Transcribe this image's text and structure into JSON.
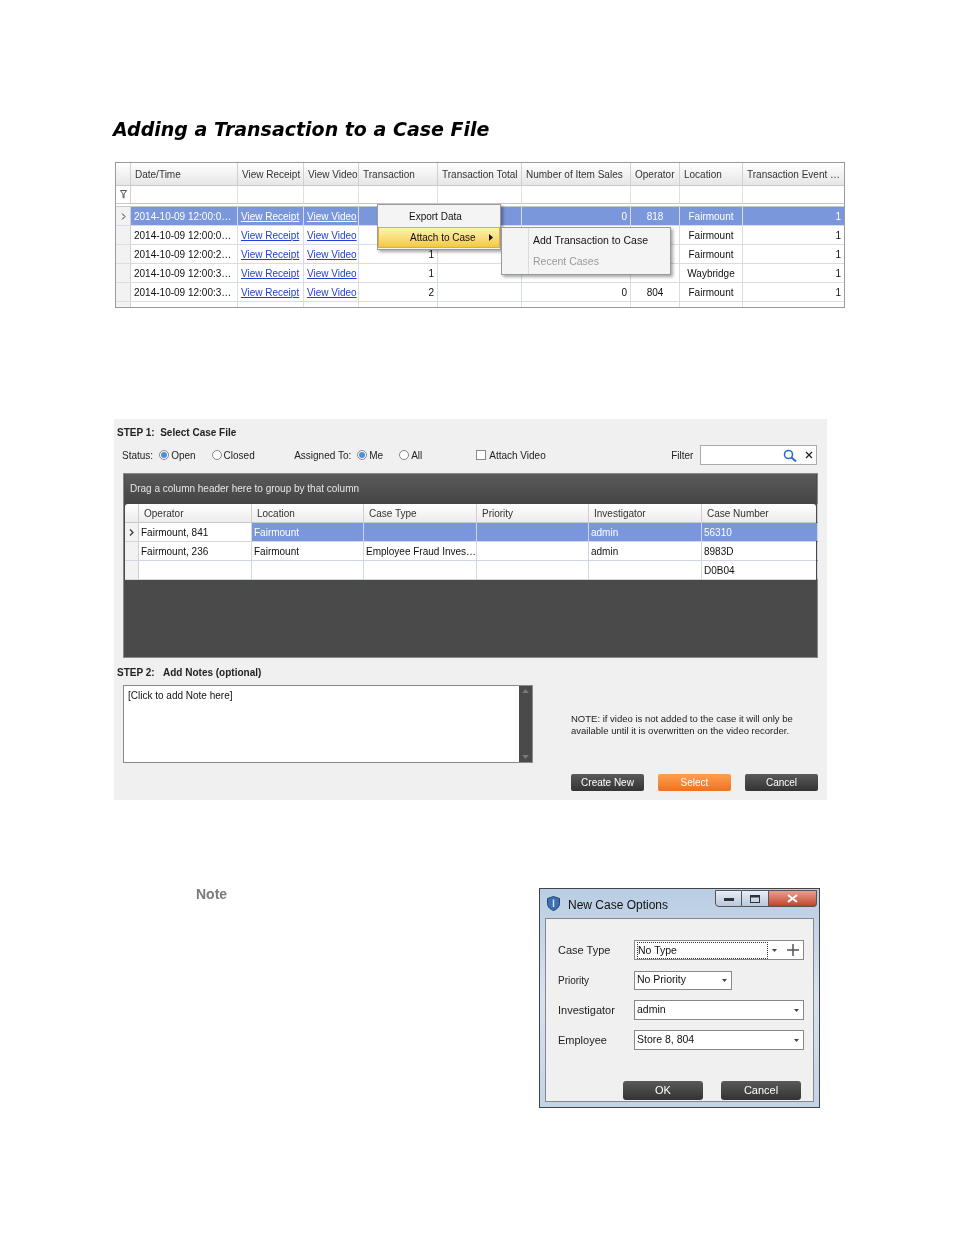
{
  "title": "Adding a Transaction to a Case File",
  "transactions_grid": {
    "columns": [
      {
        "label": "Date/Time",
        "kind": "text"
      },
      {
        "label": "View Receipt",
        "kind": "link"
      },
      {
        "label": "View Video",
        "kind": "link"
      },
      {
        "label": "Transaction",
        "kind": "number"
      },
      {
        "label": "Transaction Total",
        "kind": "number"
      },
      {
        "label": "Number of Item Sales",
        "kind": "number"
      },
      {
        "label": "Operator",
        "kind": "center"
      },
      {
        "label": "Location",
        "kind": "center"
      },
      {
        "label": "Transaction Event …",
        "kind": "number"
      }
    ],
    "rows": [
      {
        "selected": true,
        "cells": [
          "2014-10-09 12:00:0…",
          "View Receipt",
          "View Video",
          null,
          null,
          "0",
          "818",
          "Fairmount",
          "1"
        ]
      },
      {
        "selected": false,
        "cells": [
          "2014-10-09 12:00:0…",
          "View Receipt",
          "View Video",
          null,
          null,
          null,
          null,
          "Fairmount",
          "1"
        ]
      },
      {
        "selected": false,
        "cells": [
          "2014-10-09 12:00:2…",
          "View Receipt",
          "View Video",
          "1",
          null,
          null,
          null,
          "Fairmount",
          "1"
        ]
      },
      {
        "selected": false,
        "cells": [
          "2014-10-09 12:00:3…",
          "View Receipt",
          "View Video",
          "1",
          null,
          null,
          null,
          "Waybridge",
          "1"
        ]
      },
      {
        "selected": false,
        "cells": [
          "2014-10-09 12:00:3…",
          "View Receipt",
          "View Video",
          "2",
          null,
          "0",
          "804",
          "Fairmount",
          "1"
        ]
      }
    ],
    "context_menu": [
      {
        "label": "Export Data",
        "highlighted": false,
        "submenu": false
      },
      {
        "label": "Attach to Case",
        "highlighted": true,
        "submenu": true
      }
    ],
    "submenu": [
      {
        "label": "Add Transaction to Case",
        "disabled": false
      },
      {
        "label": "Recent Cases",
        "disabled": true
      }
    ]
  },
  "select_case": {
    "step1": "STEP 1:  Select Case File",
    "status_label": "Status:",
    "status_options": [
      {
        "label": "Open",
        "selected": true
      },
      {
        "label": "Closed",
        "selected": false
      }
    ],
    "assigned_label": "Assigned To:",
    "assigned_options": [
      {
        "label": "Me",
        "selected": true
      },
      {
        "label": "All",
        "selected": false
      }
    ],
    "attach_video": {
      "label": "Attach Video",
      "checked": false
    },
    "filter_label": "Filter",
    "group_hint": "Drag a column header here to group by that column",
    "columns": [
      "Operator",
      "Location",
      "Case Type",
      "Priority",
      "Investigator",
      "Case Number"
    ],
    "rows": [
      {
        "selected": true,
        "cells": [
          "Fairmount, 841",
          "Fairmount",
          null,
          null,
          "admin",
          "56310"
        ]
      },
      {
        "selected": false,
        "cells": [
          "Fairmount, 236",
          "Fairmount",
          "Employee Fraud Inves…",
          null,
          "admin",
          "8983D"
        ]
      },
      {
        "selected": false,
        "cells": [
          null,
          null,
          null,
          null,
          null,
          "D0B04"
        ]
      }
    ],
    "step2": "STEP 2:",
    "step2_title": "Add Notes (optional)",
    "notes_placeholder": "[Click to add Note here]",
    "note": "NOTE: if video is not added to the case it will only be available until it is overwritten on the video recorder.",
    "buttons": [
      {
        "label": "Create New",
        "kind": "dark"
      },
      {
        "label": "Select",
        "kind": "primary"
      },
      {
        "label": "Cancel",
        "kind": "dark"
      }
    ]
  },
  "note_heading": "Note",
  "new_case_dialog": {
    "title": "New Case Options",
    "fields": [
      {
        "label": "Case Type",
        "value": "No Type",
        "kind": "combo-add"
      },
      {
        "label": "Priority",
        "value": "No Priority",
        "kind": "combo-short"
      },
      {
        "label": "Investigator",
        "value": "admin",
        "kind": "combo"
      },
      {
        "label": "Employee",
        "value": "Store 8, 804",
        "kind": "combo"
      }
    ],
    "buttons": [
      "OK",
      "Cancel"
    ]
  }
}
